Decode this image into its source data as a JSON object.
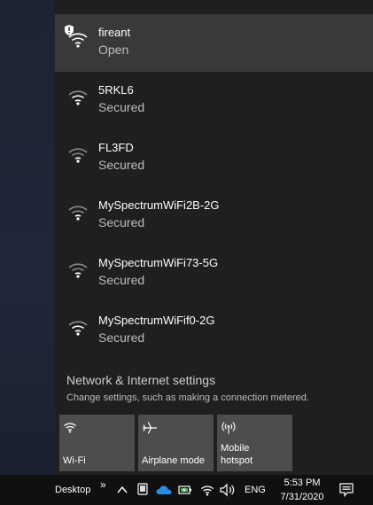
{
  "networks": [
    {
      "ssid": "fireant",
      "status": "Open",
      "secure": false
    },
    {
      "ssid": "5RKL6",
      "status": "Secured",
      "secure": true
    },
    {
      "ssid": "FL3FD",
      "status": "Secured",
      "secure": true
    },
    {
      "ssid": "MySpectrumWiFi2B-2G",
      "status": "Secured",
      "secure": true
    },
    {
      "ssid": "MySpectrumWiFi73-5G",
      "status": "Secured",
      "secure": true
    },
    {
      "ssid": "MySpectrumWiFif0-2G",
      "status": "Secured",
      "secure": true
    }
  ],
  "settings": {
    "title": "Network & Internet settings",
    "description": "Change settings, such as making a connection metered."
  },
  "quick_actions": [
    {
      "label": "Wi-Fi",
      "icon": "wifi-icon"
    },
    {
      "label": "Airplane mode",
      "icon": "airplane-icon"
    },
    {
      "label": "Mobile\nhotspot",
      "icon": "mobile-hotspot-icon"
    }
  ],
  "taskbar": {
    "desktop_label": "Desktop",
    "chevron": "»",
    "language": "ENG",
    "time": "5:53 PM",
    "date": "7/31/2020"
  },
  "colors": {
    "flyout_bg": "#1f1f1f",
    "selected_bg": "#393939",
    "tile_bg": "#4d4d4d",
    "taskbar_bg": "#101010",
    "onedrive_blue": "#2b8ee6",
    "battery_green": "#3fb950"
  }
}
